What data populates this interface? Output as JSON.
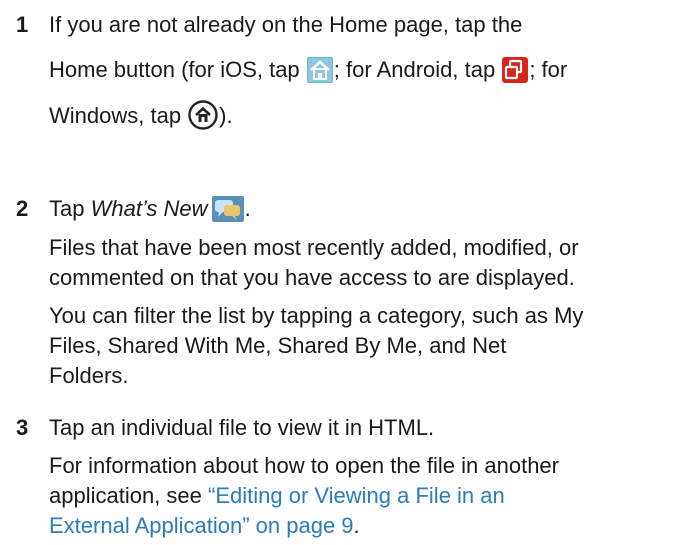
{
  "steps": [
    {
      "number": "1",
      "line1": "If you are not already on the Home page, tap the",
      "line2_a": "Home button (for iOS, tap ",
      "line2_b": "; for Android, tap ",
      "line2_c": "; for",
      "line3_a": "Windows, tap ",
      "line3_b": ")."
    },
    {
      "number": "2",
      "tap_prefix": "Tap ",
      "tap_target": "What’s New",
      "tap_suffix": ".",
      "para1_line1": "Files that have been most recently added, modified, or",
      "para1_line2": "commented on that you have access to are displayed.",
      "para2_line1": "You can filter the list by tapping a category, such as My",
      "para2_line2": "Files, Shared With Me, Shared By Me, and Net",
      "para2_line3": "Folders."
    },
    {
      "number": "3",
      "main": "Tap an individual file to view it in HTML.",
      "info_line1": "For information about how to open the file in another",
      "info_line2_a": "application, see ",
      "link_line1": "“Editing or Viewing a File in an",
      "link_line2": "External Application” on page 9",
      "info_end": "."
    }
  ],
  "icons": {
    "ios_home": "home-icon",
    "android_home": "android-home-icon",
    "windows_home": "windows-home-icon",
    "whats_new": "chat-bubbles-icon"
  },
  "colors": {
    "text": "#1a1a1a",
    "link": "#2b7bbf",
    "ios_icon": "#6fb6d4",
    "android_icon": "#d9231b",
    "whats_new_icon": "#5a8fb8"
  }
}
